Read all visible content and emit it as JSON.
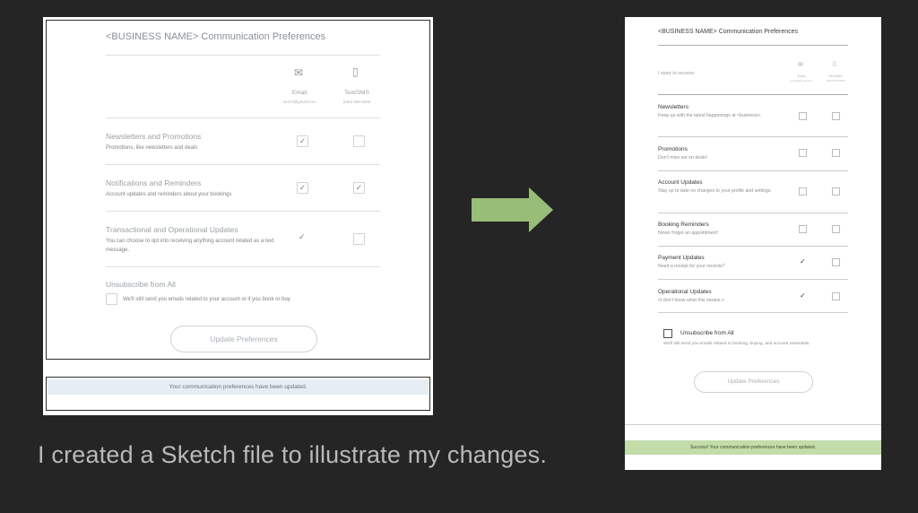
{
  "before": {
    "title": "<BUSINESS NAME> Communication Preferences",
    "columns": [
      {
        "label": "Email",
        "sub": "rachel@gmail.com",
        "icon": "envelope-icon"
      },
      {
        "label": "Text/SMS",
        "sub": "(555) 555-5555",
        "icon": "phone-icon"
      }
    ],
    "rows": [
      {
        "title": "Newsletters and Promotions",
        "desc": "Promotions, like newsletters and deals",
        "email": true,
        "sms": false
      },
      {
        "title": "Notifications and Reminders",
        "desc": "Account updates and reminders about your bookings",
        "email": true,
        "sms": true
      },
      {
        "title": "Transactional and Operational Updates",
        "desc": "You can choose to opt into receiving anything account related as a text message.",
        "email": true,
        "sms": false
      }
    ],
    "unsubscribe": {
      "title": "Unsubscribe from All",
      "desc": "We'll still send you emails related to your account or if you book or buy"
    },
    "button_label": "Update Preferences",
    "banner": "Your communication preferences have been updated."
  },
  "caption": "I created a Sketch file to illustrate my changes.",
  "after": {
    "title": "<BUSINESS NAME> Communication Preferences",
    "receive_label": "I want to receive:",
    "columns": [
      {
        "label": "Email",
        "sub": "rachel@gmail.com",
        "icon": "envelope-icon"
      },
      {
        "label": "Text/SMS",
        "sub": "(555) 555-5555",
        "icon": "phone-icon"
      }
    ],
    "rows": [
      {
        "title": "Newsletters",
        "desc": "Keep up with the latest happenings at <business>.",
        "email": false,
        "sms": false
      },
      {
        "title": "Promotions",
        "desc": "Don't miss out on deals!",
        "email": false,
        "sms": false
      },
      {
        "title": "Account Updates",
        "desc": "Stay up to date on changes to your profile and settings.",
        "email": false,
        "sms": false
      },
      {
        "title": "Booking Reminders",
        "desc": "Never forget an appointment!",
        "email": false,
        "sms": false
      },
      {
        "title": "Payment Updates",
        "desc": "Need a receipt for your records?",
        "email": true,
        "sms": false
      },
      {
        "title": "Operational Updates",
        "desc": "<I don't know what this means.>",
        "email": true,
        "sms": false
      }
    ],
    "unsubscribe": {
      "title": "Unsubscribe from All",
      "desc": "We'll still send you emails related to booking, buying, and account essentials."
    },
    "button_label": "Update Preferences",
    "banner": "Success! Your communication preferences have been updated."
  },
  "colors": {
    "background": "#252525",
    "arrow": "#97bd79",
    "success_banner": "#c2dcaa",
    "info_banner": "#e6eef4"
  }
}
